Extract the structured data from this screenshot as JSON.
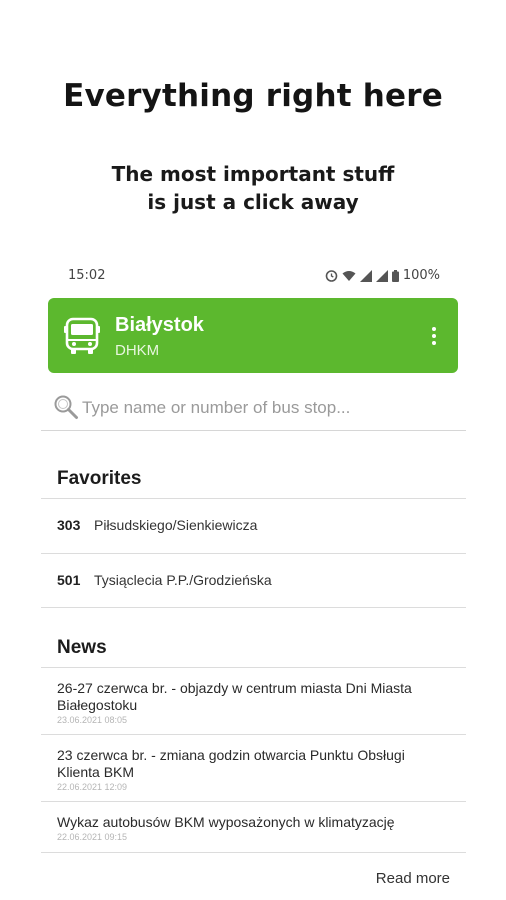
{
  "promo": {
    "title": "Everything right here",
    "subtitle_line1": "The most important stuff",
    "subtitle_line2": "is just a click away"
  },
  "status_bar": {
    "time": "15:02",
    "battery": "100%"
  },
  "header": {
    "city": "Białystok",
    "operator": "DHKM",
    "accent_color": "#5cb82e"
  },
  "search": {
    "placeholder": "Type name or number of bus stop..."
  },
  "favorites": {
    "title": "Favorites",
    "items": [
      {
        "number": "303",
        "name": "Piłsudskiego/Sienkiewicza"
      },
      {
        "number": "501",
        "name": "Tysiąclecia P.P./Grodzieńska"
      }
    ]
  },
  "news": {
    "title": "News",
    "items": [
      {
        "title": "26-27 czerwca br. - objazdy w centrum miasta Dni Miasta Białegostoku",
        "date": "23.06.2021 08:05"
      },
      {
        "title": "23 czerwca br. - zmiana godzin otwarcia Punktu Obsługi Klienta BKM",
        "date": "22.06.2021 12:09"
      },
      {
        "title": "Wykaz autobusów BKM wyposażonych w klimatyzację",
        "date": "22.06.2021 09:15"
      }
    ],
    "read_more": "Read more"
  }
}
